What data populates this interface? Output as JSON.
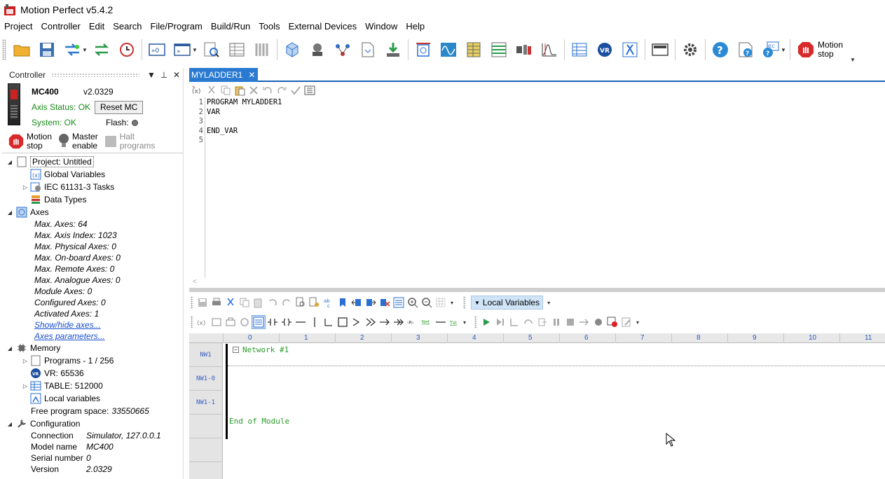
{
  "app": {
    "title": "Motion Perfect v5.4.2"
  },
  "menu": [
    "Project",
    "Controller",
    "Edit",
    "Search",
    "File/Program",
    "Build/Run",
    "Tools",
    "External Devices",
    "Window",
    "Help"
  ],
  "toolbar": {
    "motion_stop_label_1": "Motion",
    "motion_stop_label_2": "stop"
  },
  "controller_panel": {
    "header": "Controller",
    "model": "MC400",
    "version": "v2.0329",
    "axis_status": "Axis Status: OK",
    "reset_label": "Reset MC",
    "system_status": "System: OK",
    "flash_label": "Flash:",
    "motion_stop_1": "Motion",
    "motion_stop_2": "stop",
    "master_enable_1": "Master",
    "master_enable_2": "enable",
    "halt_programs_1": "Halt",
    "halt_programs_2": "programs"
  },
  "tree": {
    "project": "Project: Untitled",
    "global_variables": "Global Variables",
    "iec_tasks": "IEC 61131-3 Tasks",
    "data_types": "Data Types",
    "axes": "Axes",
    "axes_items": [
      "Max. Axes: 64",
      "Max. Axis Index: 1023",
      "Max. Physical Axes: 0",
      "Max. On-board Axes: 0",
      "Max. Remote Axes: 0",
      "Max. Analogue Axes: 0",
      "Module Axes: 0",
      "Configured Axes: 0",
      "Activated Axes: 1"
    ],
    "show_hide_axes": "Show/hide axes...",
    "axes_parameters": "Axes parameters...",
    "memory": "Memory",
    "programs": "Programs - 1 / 256",
    "vr": "VR: 65536",
    "table": "TABLE: 512000",
    "local_variables": "Local variables",
    "free_space_label": "Free program space:",
    "free_space_value": "33550665",
    "configuration": "Configuration",
    "config_rows": [
      {
        "key": "Connection",
        "value": "Simulator, 127.0.0.1"
      },
      {
        "key": "Model name",
        "value": "MC400"
      },
      {
        "key": "Serial number",
        "value": "0"
      },
      {
        "key": "Version",
        "value": "2.0329"
      }
    ]
  },
  "editor": {
    "tab_label": "MYLADDER1",
    "lines": [
      {
        "n": "1",
        "text": "PROGRAM MYLADDER1"
      },
      {
        "n": "2",
        "text": "VAR"
      },
      {
        "n": "3",
        "text": ""
      },
      {
        "n": "4",
        "text": "END_VAR"
      },
      {
        "n": "5",
        "text": ""
      }
    ],
    "scroll_marker": "<"
  },
  "ladder": {
    "local_variables_label": "Local Variables",
    "ruler": [
      "0",
      "1",
      "2",
      "3",
      "4",
      "5",
      "6",
      "7",
      "8",
      "9",
      "10",
      "11"
    ],
    "network_labels": [
      "NW1",
      "NW1-0",
      "NW1-1"
    ],
    "network_title": "Network #1",
    "end_of_module": "End of Module",
    "net_label": "Net",
    "txt_label": "Txt",
    "r_label": "‹R›"
  }
}
